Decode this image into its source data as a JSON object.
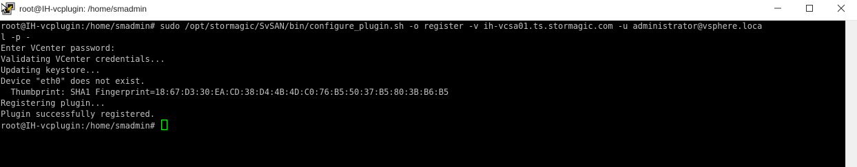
{
  "window": {
    "title": "root@IH-vcplugin: /home/smadmin",
    "icons": {
      "app": "putty-terminal-icon",
      "minimize": "minimize-icon",
      "maximize": "maximize-icon",
      "close": "close-icon"
    }
  },
  "terminal": {
    "lines": [
      "root@IH-vcplugin:/home/smadmin# sudo /opt/stormagic/SvSAN/bin/configure_plugin.sh -o register -v ih-vcsa01.ts.stormagic.com -u administrator@vsphere.loca",
      "l -p -",
      "Enter VCenter password:",
      "Validating VCenter credentials...",
      "Updating keystore...",
      "Device \"eth0\" does not exist.",
      "  Thumbprint: SHA1 Fingerprint=18:67:D3:30:EA:CD:38:D4:4B:4D:C0:76:B5:50:37:B5:80:3B:B6:B5",
      "Registering plugin...",
      "Plugin successfully registered.",
      "root@IH-vcplugin:/home/smadmin# "
    ],
    "colors": {
      "background": "#000000",
      "foreground": "#c0c0c0",
      "cursor": "#00ff00"
    }
  }
}
